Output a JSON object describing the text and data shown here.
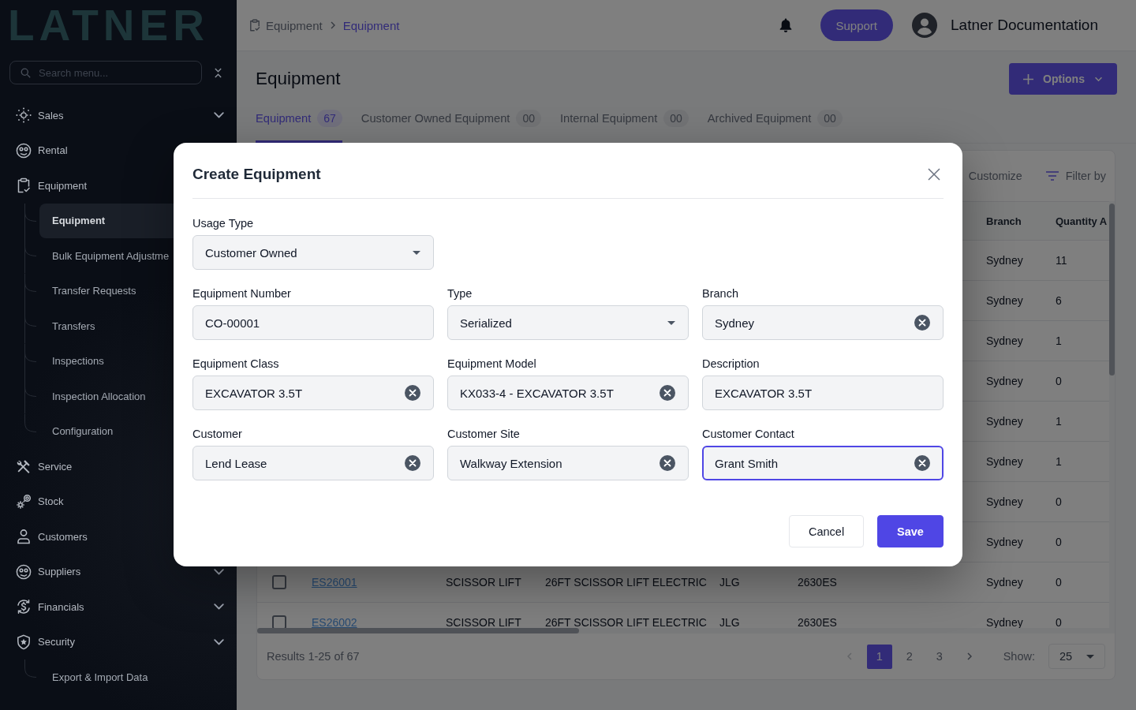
{
  "sidebar": {
    "logo": "LATNER",
    "search": {
      "placeholder": "Search menu..."
    },
    "items": [
      {
        "label": "Sales",
        "chevron": true,
        "selected": false
      },
      {
        "label": "Rental",
        "selected": false
      },
      {
        "label": "Equipment",
        "selected": false,
        "children": [
          {
            "label": "Equipment",
            "selected": true
          },
          {
            "label": "Bulk Equipment Adjustme",
            "selected": false
          },
          {
            "label": "Transfer Requests",
            "selected": false
          },
          {
            "label": "Transfers",
            "selected": false
          },
          {
            "label": "Inspections",
            "selected": false
          },
          {
            "label": "Inspection Allocation",
            "selected": false
          },
          {
            "label": "Configuration",
            "selected": false
          }
        ]
      },
      {
        "label": "Service",
        "selected": false
      },
      {
        "label": "Stock",
        "selected": false
      },
      {
        "label": "Customers",
        "selected": false
      },
      {
        "label": "Suppliers",
        "chevron": true,
        "selected": false
      },
      {
        "label": "Financials",
        "chevron": true,
        "selected": false
      },
      {
        "label": "Security",
        "chevron": true,
        "selected": false,
        "children": [
          {
            "label": "Export & Import Data",
            "selected": false
          }
        ]
      }
    ]
  },
  "topbar": {
    "breadcrumb": [
      {
        "label": "Equipment",
        "current": false
      },
      {
        "label": "Equipment",
        "current": true
      }
    ],
    "support_button": "Support",
    "user_name": "Latner Documentation"
  },
  "page": {
    "title": "Equipment",
    "options_button": "Options",
    "tabs": [
      {
        "label": "Equipment",
        "count": "67",
        "selected": true
      },
      {
        "label": "Customer Owned Equipment",
        "count": "00",
        "selected": false
      },
      {
        "label": "Internal Equipment",
        "count": "00",
        "selected": false
      },
      {
        "label": "Archived Equipment",
        "count": "00",
        "selected": false
      }
    ],
    "toolbar": {
      "customize": "Customize",
      "filter": "Filter by"
    },
    "table": {
      "headers": {
        "branch": "Branch",
        "quantity": "Quantity A"
      },
      "rows": [
        {
          "branch": "Sydney",
          "quantity": "11"
        },
        {
          "branch": "Sydney",
          "quantity": "6"
        },
        {
          "branch": "Sydney",
          "quantity": "1"
        },
        {
          "branch": "Sydney",
          "quantity": "0"
        },
        {
          "branch": "Sydney",
          "quantity": "1"
        },
        {
          "branch": "Sydney",
          "quantity": "1"
        },
        {
          "branch": "Sydney",
          "quantity": "0"
        },
        {
          "branch": "Sydney",
          "quantity": "0"
        },
        {
          "checked": false,
          "column_1": "ES26001",
          "column_2": "SCISSOR LIFT",
          "column_3": "26FT SCISSOR LIFT ELECTRIC",
          "column_4": "JLG",
          "column_5": "2630ES",
          "branch": "Sydney",
          "quantity": "0"
        },
        {
          "checked": false,
          "column_1": "ES26002",
          "column_2": "SCISSOR LIFT",
          "column_3": "26FT SCISSOR LIFT ELECTRIC",
          "column_4": "JLG",
          "column_5": "2630ES",
          "branch": "Sydney",
          "quantity": "0"
        }
      ]
    },
    "pagination": {
      "summary": "Results 1-25 of 67",
      "previous_disabled": true,
      "next_disabled": false,
      "pages": [
        {
          "label": "1",
          "selected": true
        },
        {
          "label": "2",
          "selected": false
        },
        {
          "label": "3",
          "selected": false
        }
      ],
      "show_label": "Show:",
      "page_size": "25"
    }
  },
  "modal": {
    "title": "Create Equipment",
    "usage_type": {
      "label": "Usage Type",
      "value": "Customer Owned",
      "kind": "select",
      "focused": false
    },
    "fields": [
      {
        "label": "Equipment Number",
        "value": "CO-00001",
        "kind": "text",
        "focused": false
      },
      {
        "label": "Type",
        "value": "Serialized",
        "kind": "select",
        "focused": false
      },
      {
        "label": "Branch",
        "value": "Sydney",
        "kind": "clearable",
        "focused": false
      },
      {
        "label": "Equipment Class",
        "value": "EXCAVATOR 3.5T",
        "kind": "clearable",
        "focused": false
      },
      {
        "label": "Equipment Model",
        "value": "KX033-4 - EXCAVATOR 3.5T",
        "kind": "clearable",
        "focused": false
      },
      {
        "label": "Description",
        "value": "EXCAVATOR 3.5T",
        "kind": "text",
        "focused": false
      },
      {
        "label": "Customer",
        "value": "Lend Lease",
        "kind": "clearable",
        "focused": false
      },
      {
        "label": "Customer Site",
        "value": "Walkway Extension",
        "kind": "clearable",
        "focused": false
      },
      {
        "label": "Customer Contact",
        "value": "Grant Smith",
        "kind": "clearable",
        "focused": true
      }
    ],
    "buttons": [
      {
        "label": "Cancel",
        "kind": "secondary"
      },
      {
        "label": "Save",
        "kind": "primary"
      }
    ]
  }
}
